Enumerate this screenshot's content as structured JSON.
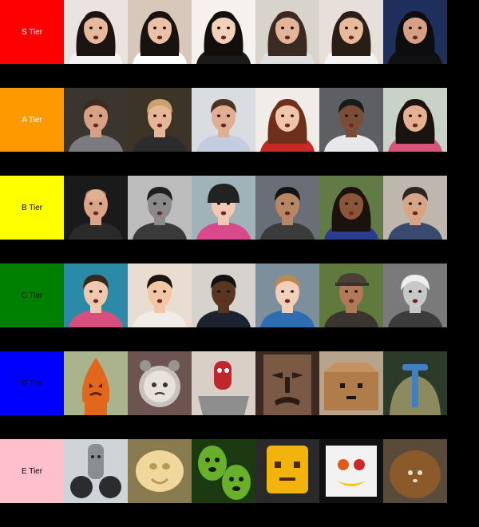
{
  "tiers": [
    {
      "label": "S Tier",
      "color": "#ff0000",
      "text_color": "#ffffff",
      "items": [
        {
          "icon": "woman-face-icon",
          "bg": "#e9e4df",
          "skin": "#e8b89a",
          "hair": "#1b1410",
          "shirt": "#f2f2f2"
        },
        {
          "icon": "woman-face-icon",
          "bg": "#d8c8bb",
          "skin": "#eac0a6",
          "hair": "#181210",
          "shirt": "#ffffff"
        },
        {
          "icon": "woman-face-icon",
          "bg": "#f4f1ee",
          "skin": "#f2d0ba",
          "hair": "#120e0c",
          "shirt": "#1a1a1a"
        },
        {
          "icon": "woman-face-icon",
          "bg": "#d9d3ce",
          "skin": "#e4b49a",
          "hair": "#3a2a22",
          "shirt": "#e0e0e0"
        },
        {
          "icon": "woman-face-icon",
          "bg": "#e7e0da",
          "skin": "#e7ba9c",
          "hair": "#2a1d16",
          "shirt": "#f4f4f4"
        },
        {
          "icon": "woman-face-icon",
          "bg": "#1d2f5a",
          "skin": "#d7a084",
          "hair": "#0d0d10",
          "shirt": "#111111"
        }
      ]
    },
    {
      "label": "A Tier",
      "color": "#ff9900",
      "text_color": "#ffffff",
      "items": [
        {
          "icon": "man-face-icon",
          "bg": "#3b3530",
          "skin": "#d9a183",
          "hair": "#3e2a1f",
          "shirt": "#7a7a80"
        },
        {
          "icon": "man-face-icon",
          "bg": "#3d3428",
          "skin": "#e7b696",
          "hair": "#c8a36a",
          "shirt": "#2c2c2c"
        },
        {
          "icon": "man-face-icon",
          "bg": "#d9dde2",
          "skin": "#e0ae92",
          "hair": "#4a3322",
          "shirt": "#c4cde0"
        },
        {
          "icon": "woman-face-icon",
          "bg": "#f0ece8",
          "skin": "#f0c4a8",
          "hair": "#6e2f1c",
          "shirt": "#c52a24"
        },
        {
          "icon": "man-face-icon",
          "bg": "#5d5f63",
          "skin": "#7a4e36",
          "hair": "#1a1a1a",
          "shirt": "#e8e8ea"
        },
        {
          "icon": "woman-face-icon",
          "bg": "#c8d2c6",
          "skin": "#e4b090",
          "hair": "#1a1411",
          "shirt": "#d8557a"
        }
      ]
    },
    {
      "label": "B Tier",
      "color": "#ffff00",
      "text_color": "#000000",
      "items": [
        {
          "icon": "bald-man-face-icon",
          "bg": "#1a1a1a",
          "skin": "#d9a488",
          "hair": "#d9a488",
          "shirt": "#2a2a2a"
        },
        {
          "icon": "man-face-icon",
          "bg": "#bdbdbd",
          "skin": "#8a8a8a",
          "hair": "#1f1f1f",
          "shirt": "#3a3a3a"
        },
        {
          "icon": "child-helmet-face-icon",
          "bg": "#9fb3b8",
          "skin": "#f2c8b4",
          "hair": "#222222",
          "shirt": "#d94a8c"
        },
        {
          "icon": "man-face-icon",
          "bg": "#6a6e76",
          "skin": "#b88664",
          "hair": "#141414",
          "shirt": "#3b3b3b"
        },
        {
          "icon": "woman-face-icon",
          "bg": "#627a46",
          "skin": "#8a5538",
          "hair": "#1b120d",
          "shirt": "#2c3c8e"
        },
        {
          "icon": "man-face-icon",
          "bg": "#bfb7ad",
          "skin": "#d8a486",
          "hair": "#2e2520",
          "shirt": "#3a4a6e"
        }
      ]
    },
    {
      "label": "C Tier",
      "color": "#008000",
      "text_color": "#000000",
      "items": [
        {
          "icon": "child-face-icon",
          "bg": "#2b8aa8",
          "skin": "#f1c7ad",
          "hair": "#3a2818",
          "shirt": "#d74f7e"
        },
        {
          "icon": "baby-face-icon",
          "bg": "#e9dcd0",
          "skin": "#f2c6a4",
          "hair": "#1e1510",
          "shirt": "#f2ece6"
        },
        {
          "icon": "man-face-icon",
          "bg": "#d6d3cf",
          "skin": "#5a3622",
          "hair": "#121010",
          "shirt": "#1d2230"
        },
        {
          "icon": "child-face-icon",
          "bg": "#7d8e9c",
          "skin": "#f2cfb6",
          "hair": "#b58a55",
          "shirt": "#2f6db2"
        },
        {
          "icon": "old-man-cap-face-icon",
          "bg": "#5f7a3c",
          "skin": "#b07a5a",
          "hair": "#d9d2c6",
          "shirt": "#3b3530"
        },
        {
          "icon": "old-woman-face-icon",
          "bg": "#7a7a7a",
          "skin": "#c8c8c8",
          "hair": "#eeeeee",
          "shirt": "#3c3c3c"
        }
      ]
    },
    {
      "label": "D Tier",
      "color": "#0000ff",
      "text_color": "#000000",
      "items": [
        {
          "icon": "orange-cone-face-icon",
          "bg": "#a9b48c",
          "main": "#e2661c",
          "accent": "#5a1f08"
        },
        {
          "icon": "alarm-clock-face-icon",
          "bg": "#6c5450",
          "main": "#c9c2bc",
          "accent": "#3a3230"
        },
        {
          "icon": "red-toy-face-icon",
          "bg": "#d8d0c6",
          "main": "#c0262b",
          "accent": "#8e8e8e"
        },
        {
          "icon": "carved-face-icon",
          "bg": "#3a2a22",
          "main": "#7a5a44",
          "accent": "#2a1c14"
        },
        {
          "icon": "cardboard-box-face-icon",
          "bg": "#b8a48c",
          "main": "#b07c4a",
          "accent": "#1b1410"
        },
        {
          "icon": "mop-face-icon",
          "bg": "#2c3a2a",
          "main": "#8e8a60",
          "accent": "#3f7fc4"
        }
      ]
    },
    {
      "label": "E Tier",
      "color": "#ffc0cb",
      "text_color": "#000000",
      "items": [
        {
          "icon": "jet-engine-face-icon",
          "bg": "#cfd4d8",
          "main": "#8a8e92",
          "accent": "#2a2c2e"
        },
        {
          "icon": "pasta-face-icon",
          "bg": "#8a7a50",
          "main": "#f0d89c",
          "accent": "#b89a56"
        },
        {
          "icon": "green-pepper-face-icon",
          "bg": "#1c3a12",
          "main": "#69b02a",
          "accent": "#0d1a08"
        },
        {
          "icon": "yellow-box-face-icon",
          "bg": "#2a2a2a",
          "main": "#f2b40c",
          "accent": "#4a2a08"
        },
        {
          "icon": "fruit-plate-face-icon",
          "bg": "#111111",
          "main": "#f2f2f2",
          "accent": "#f2c412"
        },
        {
          "icon": "jar-face-icon",
          "bg": "#5a4a3a",
          "main": "#8a5a2a",
          "accent": "#f2e2c6"
        }
      ]
    }
  ]
}
